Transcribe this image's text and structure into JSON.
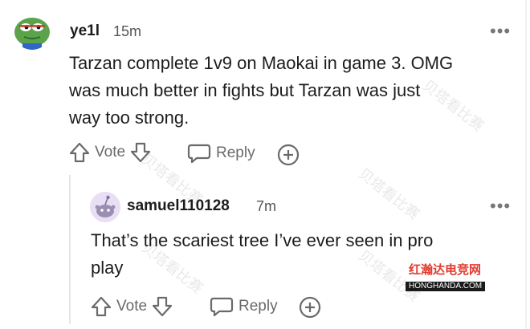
{
  "comments": [
    {
      "author": "ye1l",
      "age": "15m",
      "body_lines": [
        "Tarzan complete 1v9 on Maokai in game 3. OMG",
        "was much better in fights but Tarzan was just",
        "way too strong."
      ],
      "vote_label": "Vote",
      "reply_label": "Reply",
      "more_label": "•••"
    },
    {
      "author": "samuel110128",
      "age": "7m",
      "body_lines": [
        "That’s the scariest tree I’ve ever seen in pro",
        "play"
      ],
      "vote_label": "Vote",
      "reply_label": "Reply",
      "more_label": "•••"
    }
  ],
  "watermark": "贝塔看比赛",
  "brand": {
    "name_cn": "红瀚达电竞网",
    "domain": "HONGHANDA.COM"
  },
  "colors": {
    "text": "#1c1c1c",
    "muted": "#6a6a6a",
    "brand_red": "#e03a2e",
    "avatar_green": "#5aa34a"
  }
}
